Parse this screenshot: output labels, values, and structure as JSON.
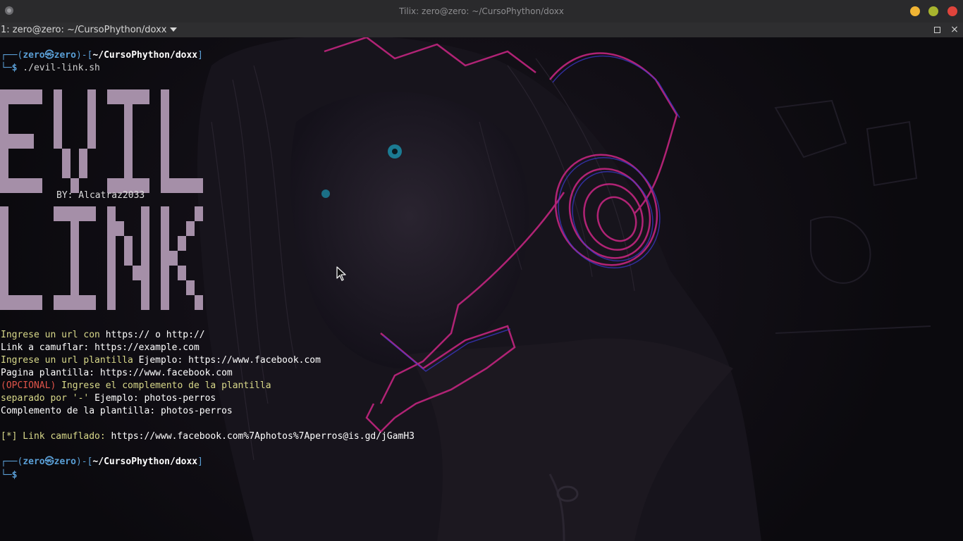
{
  "window": {
    "title": "Tilix: zero@zero: ~/CursoPhython/doxx",
    "session_label": "1: zero@zero: ~/CursoPhython/doxx"
  },
  "terminal": {
    "prompt1": {
      "frame_open": "┌──(",
      "user": "zero㉿zero",
      "frame_mid": ")-[",
      "path": "~/CursoPhython/doxx",
      "frame_close": "]",
      "frame_second": "└─",
      "dollar": "$",
      "command": " ./evil-link.sh"
    },
    "banner": {
      "word1": "EVIL",
      "word2": "LINK",
      "byline": "BY: Alcatraz2033",
      "color": "#a58fa8"
    },
    "output": {
      "l1_prefix": "Ingrese un url con ",
      "l1_value": "https:// o http://",
      "l2_prefix": "Link a camuflar: ",
      "l2_value": "https://example.com",
      "l3_prefix": "Ingrese un url plantilla ",
      "l3_value": "Ejemplo: https://www.facebook.com",
      "l4_prefix": "Pagina plantilla: ",
      "l4_value": "https://www.facebook.com",
      "l5_red": "(OPCIONAL)",
      "l5_rest": " Ingrese el complemento de la plantilla",
      "l6_prefix": "separado por '-' ",
      "l6_value": "Ejemplo: photos-perros",
      "l7_prefix": "Complemento de la plantilla: ",
      "l7_value": "photos-perros",
      "l8_prefix": "[*] Link camuflado: ",
      "l8_value": "https://www.facebook.com%7Aphotos%7Aperros@is.gd/jGamH3"
    },
    "prompt2": {
      "frame_open": "┌──(",
      "user": "zero㉿zero",
      "frame_mid": ")-[",
      "path": "~/CursoPhython/doxx",
      "frame_close": "]",
      "frame_second": "└─",
      "dollar": "$"
    }
  },
  "icons": {
    "app": "tilix-app-icon",
    "minimize": "minimize-icon",
    "maximize": "maximize-icon",
    "close": "close-icon",
    "cursor": "mouse-pointer-icon"
  },
  "colors": {
    "titlebar": "#2a2a2c",
    "prompt_blue": "#5a9fd6",
    "prompt_text_yellow": "#d9d98a",
    "error_red": "#e0544a",
    "neon_pink": "#c2257f",
    "neon_blue": "#3d3bd6"
  }
}
